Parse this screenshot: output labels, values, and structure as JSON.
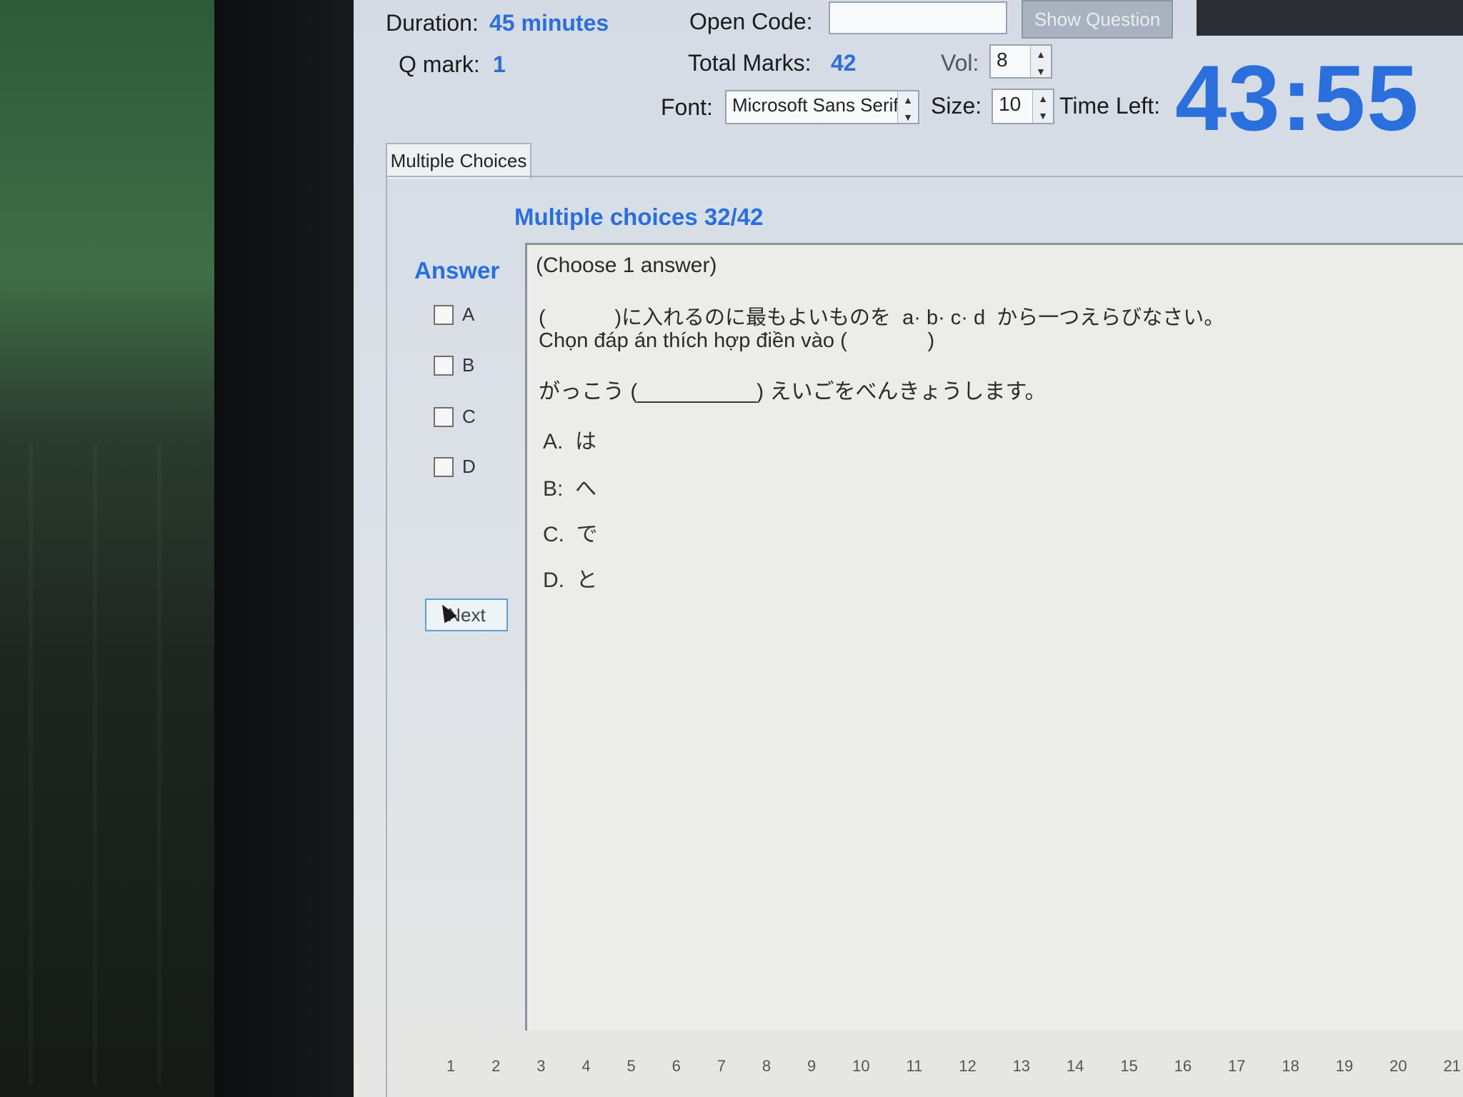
{
  "header": {
    "duration_label": "Duration:",
    "duration_value": "45 minutes",
    "qmark_label": "Q mark:",
    "qmark_value": "1",
    "open_code_label": "Open Code:",
    "open_code_value": "",
    "show_question_label": "Show Question",
    "total_marks_label": "Total Marks:",
    "total_marks_value": "42",
    "vol_label": "Vol:",
    "vol_value": "8",
    "font_label": "Font:",
    "font_value": "Microsoft Sans Serif",
    "size_label": "Size:",
    "size_value": "10",
    "time_left_label": "Time Left:",
    "time_left_value": "43:55"
  },
  "tabs": [
    {
      "label": "Multiple Choices",
      "selected": true
    }
  ],
  "question": {
    "heading": "Multiple choices 32/42",
    "instruction": "(Choose 1 answer)",
    "prompt_jp": "(            )に入れるのに最もよいものを  a· b· c· d  から一つえらびなさい。",
    "prompt_vi": "Chọn đáp án thích hợp điền vào (              )",
    "sentence": "がっこう (__________) えいごをべんきょうします。",
    "choices": [
      {
        "label": "A.  は"
      },
      {
        "label": "B:  へ"
      },
      {
        "label": "C.  で"
      },
      {
        "label": "D.  と"
      }
    ]
  },
  "answer_panel": {
    "title": "Answer",
    "options": [
      {
        "label": "A",
        "checked": false
      },
      {
        "label": "B",
        "checked": false
      },
      {
        "label": "C",
        "checked": false
      },
      {
        "label": "D",
        "checked": false
      }
    ],
    "next_label": "Next"
  },
  "pager": [
    "1",
    "2",
    "3",
    "4",
    "5",
    "6",
    "7",
    "8",
    "9",
    "10",
    "11",
    "12",
    "13",
    "14",
    "15",
    "16",
    "17",
    "18",
    "19",
    "20",
    "21"
  ],
  "colors": {
    "accent": "#2a6fdc",
    "window_bg": "#d4dbe5"
  }
}
